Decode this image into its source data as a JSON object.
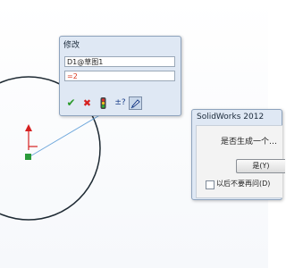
{
  "modify_dialog": {
    "title": "修改",
    "dimension_name": "D1@草图1",
    "value_text": "=2",
    "toolbar": {
      "ok_icon": "✔",
      "cancel_icon": "✖",
      "rebuild_icon": "traffic-light-icon",
      "reverse_icon": "±?",
      "mark_icon": "pin-icon"
    }
  },
  "solidworks_dialog": {
    "title": "SolidWorks 2012",
    "message": "是否生成一个⁠…",
    "yes_label": "是(Y)",
    "dont_ask_label": "以后不要再问(D)"
  },
  "colors": {
    "accept": "#2a9a2a",
    "cancel": "#d62020",
    "dimension_value": "#d9381e",
    "sketch_line": "#1e2a33",
    "construction_line": "#6fa8dc"
  }
}
